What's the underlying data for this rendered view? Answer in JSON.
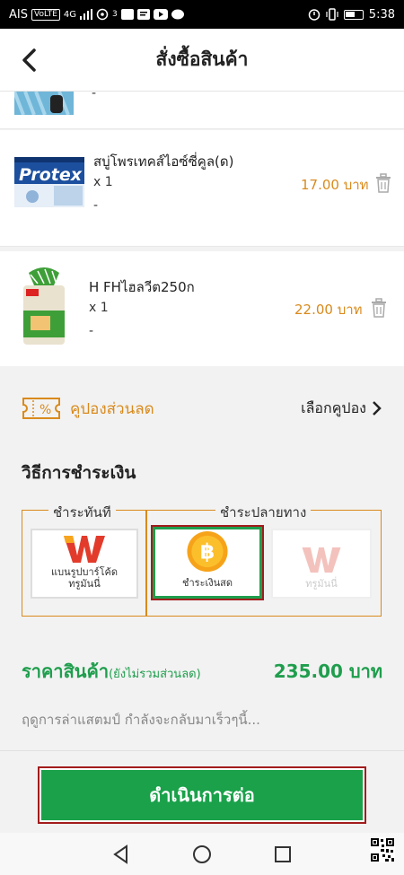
{
  "status_bar": {
    "carrier": "AIS",
    "volte": "VoLTE",
    "network": "4G",
    "sim_slot": "3",
    "time": "5:38"
  },
  "header": {
    "title": "สั่งซื้อสินค้า"
  },
  "items": [
    {
      "name": "",
      "qty": "",
      "note": "-",
      "price": ""
    },
    {
      "name": "สบู่โพรเทคส์ไอซ์ซี่คูล(ด)",
      "qty": "x 1",
      "note": "-",
      "price": "17.00 บาท"
    },
    {
      "name": "H FHไฮลวีต250ก",
      "qty": "x 1",
      "note": "-",
      "price": "22.00 บาท"
    }
  ],
  "coupon": {
    "label": "คูปองส่วนลด",
    "select": "เลือกคูปอง"
  },
  "payment": {
    "title": "วิธีการชำระเงิน",
    "group_now": "ชำระทันที",
    "group_later": "ชำระปลายทาง",
    "options": [
      {
        "label_line1": "แบนรูปบาร์โค้ด",
        "label_line2": "ทรูมันนี่"
      },
      {
        "label": "ชำระเงินสด"
      },
      {
        "label": "ทรูมันนี่"
      }
    ]
  },
  "price": {
    "label": "ราคาสินค้า",
    "note": "(ยังไม่รวมส่วนลด)",
    "value": "235.00 บาท"
  },
  "promo_text": "ฤดูการล่าแสตมป์ กำลังจะกลับมาเร็วๆนี้...",
  "cta_label": "ดำเนินการต่อ",
  "colors": {
    "accent_orange": "#d98a1c",
    "brand_green": "#1aa14a",
    "highlight_red": "#a21c1c"
  }
}
